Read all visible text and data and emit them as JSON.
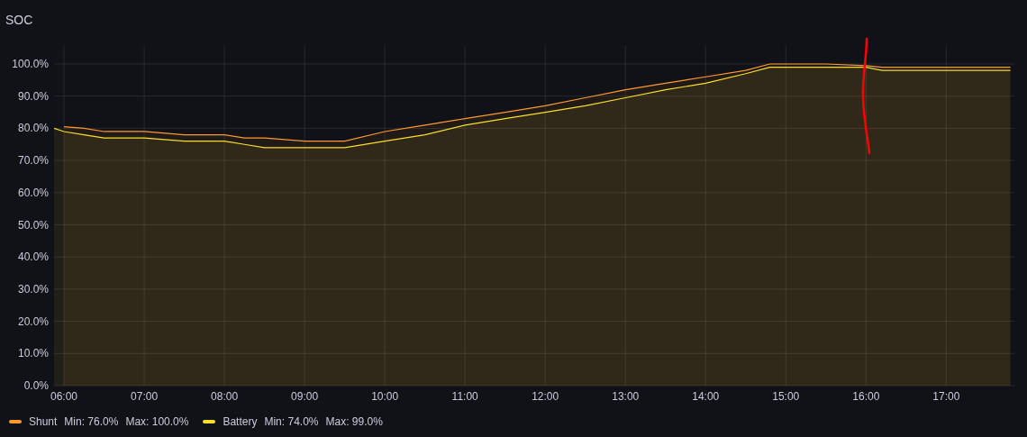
{
  "panel": {
    "title": "SOC",
    "chart_data": {
      "type": "area",
      "grid": true,
      "xlim": [
        5.876,
        17.85
      ],
      "ylim": [
        0,
        100
      ],
      "x": [
        5.876,
        6,
        6.25,
        6.5,
        7,
        7.5,
        8,
        8.25,
        8.5,
        9,
        9.5,
        10,
        10.5,
        11,
        11.5,
        12,
        12.5,
        13,
        13.5,
        14,
        14.5,
        14.8,
        15,
        15.5,
        16,
        16.2,
        17.8
      ],
      "series": [
        {
          "name": "Shunt",
          "color": "#ff9830",
          "values": [
            null,
            80.5,
            80,
            79,
            79,
            78,
            78,
            77,
            77,
            76,
            76,
            79,
            81,
            83,
            85,
            87,
            89.5,
            92,
            94,
            96,
            98,
            100,
            100,
            100,
            99.5,
            99,
            99
          ]
        },
        {
          "name": "Battery",
          "color": "#fade2a",
          "values": [
            80,
            79,
            78,
            77,
            77,
            76,
            76,
            75,
            74,
            74,
            74,
            76,
            78,
            81,
            83,
            85,
            87,
            89.5,
            92,
            94,
            97,
            99,
            99,
            99,
            99,
            98,
            98
          ]
        }
      ],
      "xticks": [
        {
          "value": 6,
          "label": "06:00"
        },
        {
          "value": 7,
          "label": "07:00"
        },
        {
          "value": 8,
          "label": "08:00"
        },
        {
          "value": 9,
          "label": "09:00"
        },
        {
          "value": 10,
          "label": "10:00"
        },
        {
          "value": 11,
          "label": "11:00"
        },
        {
          "value": 12,
          "label": "12:00"
        },
        {
          "value": 13,
          "label": "13:00"
        },
        {
          "value": 14,
          "label": "14:00"
        },
        {
          "value": 15,
          "label": "15:00"
        },
        {
          "value": 16,
          "label": "16:00"
        },
        {
          "value": 17,
          "label": "17:00"
        }
      ],
      "yticks": [
        {
          "value": 0,
          "label": "0.0%"
        },
        {
          "value": 10,
          "label": "10.0%"
        },
        {
          "value": 20,
          "label": "20.0%"
        },
        {
          "value": 30,
          "label": "30.0%"
        },
        {
          "value": 40,
          "label": "40.0%"
        },
        {
          "value": 50,
          "label": "50.0%"
        },
        {
          "value": 60,
          "label": "60.0%"
        },
        {
          "value": 70,
          "label": "70.0%"
        },
        {
          "value": 80,
          "label": "80.0%"
        },
        {
          "value": 90,
          "label": "90.0%"
        },
        {
          "value": 100,
          "label": "100.0%"
        }
      ]
    }
  },
  "legend": [
    {
      "min": "Min: 76.0%",
      "max": "Max: 100.0%"
    },
    {
      "min": "Min: 74.0%",
      "max": "Max: 99.0%"
    }
  ]
}
